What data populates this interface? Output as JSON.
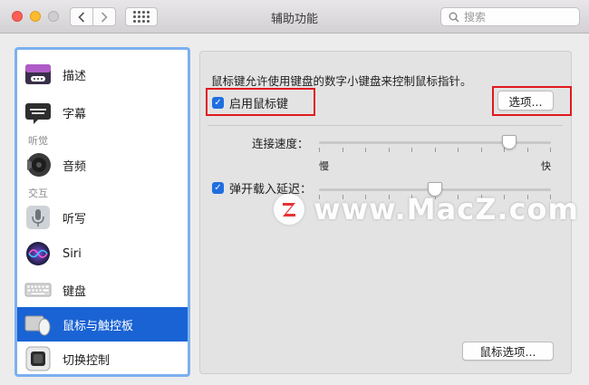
{
  "window": {
    "title": "辅助功能",
    "search_placeholder": "搜索"
  },
  "sidebar": {
    "items": [
      {
        "label": "描述",
        "icon": "description-icon"
      },
      {
        "label": "字幕",
        "icon": "captions-icon"
      },
      {
        "label": "音频",
        "icon": "speaker-icon"
      },
      {
        "label": "听写",
        "icon": "microphone-icon"
      },
      {
        "label": "Siri",
        "icon": "siri-icon"
      },
      {
        "label": "键盘",
        "icon": "keyboard-icon"
      },
      {
        "label": "鼠标与触控板",
        "icon": "mouse-icon",
        "selected": true
      },
      {
        "label": "切换控制",
        "icon": "switch-control-icon"
      }
    ],
    "headers": {
      "hearing": "听觉",
      "interaction": "交互"
    }
  },
  "main": {
    "description": "鼠标键允许使用键盘的数字小键盘来控制鼠标指针。",
    "enable_mouse_keys": {
      "label": "启用鼠标键",
      "checked": true
    },
    "options_button": "选项...",
    "speed": {
      "label": "连接速度：",
      "min_label": "慢",
      "max_label": "快",
      "value": 0.82
    },
    "delay": {
      "label": "弹开载入延迟：",
      "checked": true,
      "value": 0.5
    },
    "mouse_options_button": "鼠标选项..."
  },
  "watermark": {
    "text": "www.MacZ.com"
  },
  "colors": {
    "accent": "#1a63d4",
    "highlight_box": "#e0191f"
  }
}
